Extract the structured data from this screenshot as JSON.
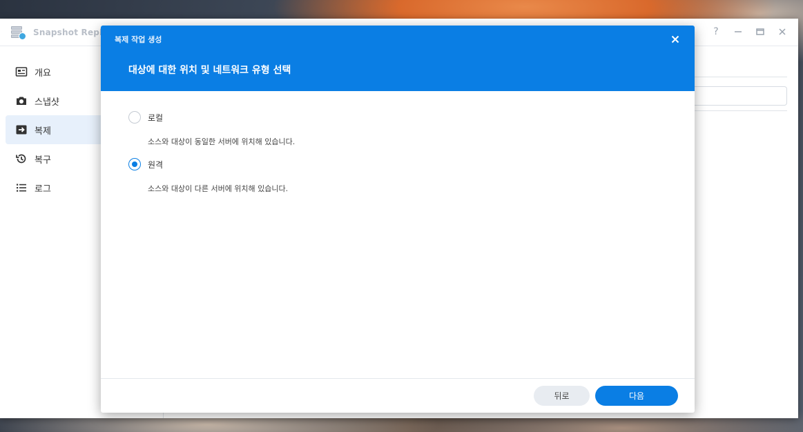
{
  "app": {
    "title": "Snapshot Repl",
    "icon": "snapshot-replication-icon",
    "window_controls": {
      "help": "?",
      "help_icon": "help-icon",
      "minimize_icon": "minimize-icon",
      "maximize_icon": "maximize-icon",
      "close_icon": "close-icon"
    },
    "sidebar": {
      "items": [
        {
          "label": "개요",
          "icon": "overview-icon",
          "active": false
        },
        {
          "label": "스냅샷",
          "icon": "camera-icon",
          "active": false
        },
        {
          "label": "복제",
          "icon": "replication-icon",
          "active": true
        },
        {
          "label": "복구",
          "icon": "history-icon",
          "active": false
        },
        {
          "label": "로그",
          "icon": "list-icon",
          "active": false
        }
      ]
    }
  },
  "modal": {
    "small_title": "복제 작업 생성",
    "heading": "대상에 대한 위치 및 네트워크 유형 선택",
    "close_icon": "close-icon",
    "options": [
      {
        "label": "로컬",
        "description": "소스와 대상이 동일한 서버에 위치해 있습니다.",
        "checked": false
      },
      {
        "label": "원격",
        "description": "소스와 대상이 다른 서버에 위치해 있습니다.",
        "checked": true
      }
    ],
    "buttons": {
      "back": "뒤로",
      "next": "다음"
    }
  },
  "colors": {
    "accent": "#0a7ee4",
    "sidebar_active_bg": "#e7f0fb",
    "back_button_bg": "#e8ecf1"
  }
}
